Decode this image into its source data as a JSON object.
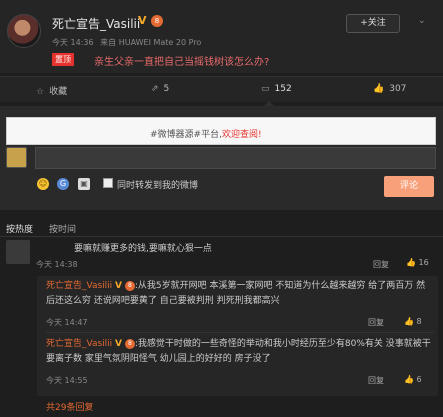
{
  "post": {
    "author": "死亡宣告_Vasilii",
    "verified_badge": "V",
    "level_badge": "8",
    "time": "今天 14:36",
    "source": "来自 HUAWEI Mate 20 Pro",
    "follow_label": "+关注",
    "top_tag": "置顶",
    "text": "亲生父亲一直把自己当摇钱树该怎么办?"
  },
  "actions": [
    {
      "icon": "star-icon",
      "glyph": "☆",
      "label": "收藏"
    },
    {
      "icon": "share-icon",
      "glyph": "⇗",
      "label": "5"
    },
    {
      "icon": "comment-icon",
      "glyph": "▭",
      "label": "152"
    },
    {
      "icon": "like-icon",
      "glyph": "👍",
      "label": "307"
    }
  ],
  "reply": {
    "placeholder_prefix": "#微博器源#平台,",
    "placeholder_highlight": "欢迎查阅!",
    "checkbox_label": "同时转发到我的微博",
    "submit_label": "评论"
  },
  "sort": {
    "by_hot": "按热度",
    "by_time": "按时间"
  },
  "comments": [
    {
      "text": "要嘛就赚更多的钱,要嘛就心狠一点",
      "time": "今天 14:38",
      "reply_label": "回复",
      "likes": "16"
    }
  ],
  "sub_replies": [
    {
      "name": "死亡宣告_Vasilii",
      "vb": "V",
      "lb": "8",
      "text": ":从我5岁就开网吧 本溪第一家网吧 不知道为什么越来越穷 给了两百万 然后还这么穷 还说网吧要黄了 自己要被判刑 判死刑我都高兴",
      "time": "今天 14:47",
      "reply_label": "回复",
      "likes": "8"
    },
    {
      "name": "死亡宣告_Vasilii",
      "vb": "V",
      "lb": "8",
      "text": ":我感觉干时做的一些奇怪的举动和我小时经历至少有80%有关 没事就被干 要离子数 家里气氛阴阳怪气 幼儿园上的好好的 房子没了",
      "time": "今天 14:55",
      "reply_label": "回复",
      "likes": "6"
    }
  ],
  "more_replies": "共29条回复",
  "colors": {
    "accent": "#e46a33",
    "top_tag": "#e5322c",
    "post_text": "#e86a6a",
    "submit": "#f7a07a"
  }
}
